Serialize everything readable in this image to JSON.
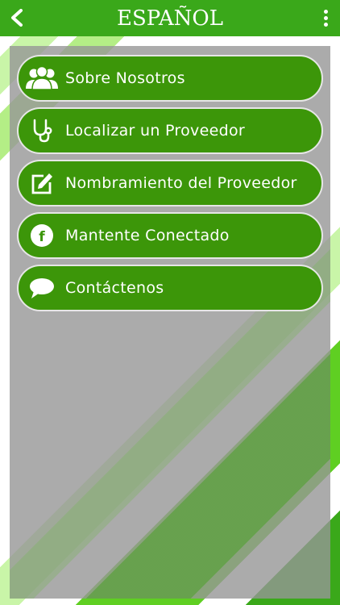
{
  "header": {
    "title": "ESPAÑOL",
    "back_icon": "chevron-left-icon",
    "menu_icon": "more-vertical-icon"
  },
  "menu": {
    "items": [
      {
        "label": "Sobre Nosotros",
        "icon": "users-icon"
      },
      {
        "label": "Localizar un Proveedor",
        "icon": "stethoscope-icon"
      },
      {
        "label": "Nombramiento del Proveedor",
        "icon": "edit-icon"
      },
      {
        "label": "Mantente Conectado",
        "icon": "facebook-icon"
      },
      {
        "label": "Contáctenos",
        "icon": "chat-bubble-icon"
      }
    ]
  },
  "colors": {
    "accent": "#3aa81a",
    "button": "#3c9609",
    "button_border": "#e6e6e6",
    "panel": "#969696"
  }
}
